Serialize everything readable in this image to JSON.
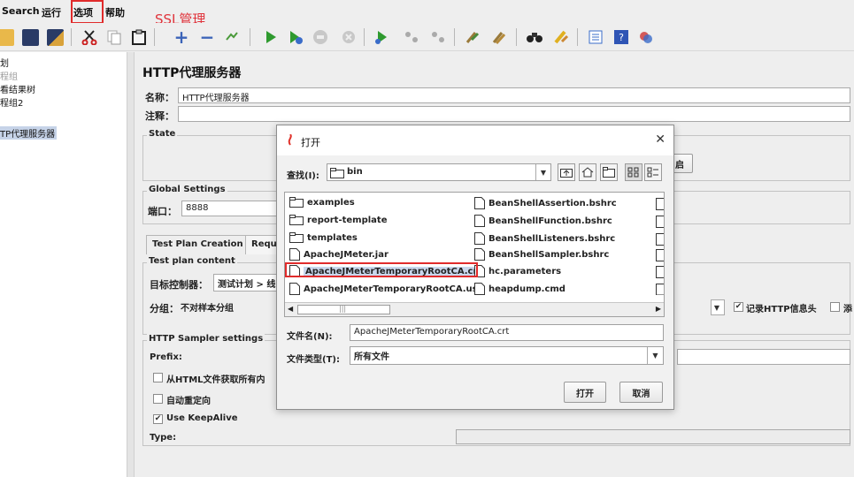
{
  "menu": {
    "items": [
      "Search",
      "运行",
      "选项",
      "帮助"
    ],
    "highlighted": "选项"
  },
  "annotation": {
    "text": "SSL管理",
    "color": "#e0323a"
  },
  "toolbar": {
    "icons": [
      "new-icon",
      "open-icon",
      "save-icon",
      "save-as-icon",
      "cut-icon",
      "copy-icon",
      "paste-icon",
      "expand-icon",
      "collapse-icon",
      "toggle-icon",
      "start-icon",
      "start-no-pause-icon",
      "stop-icon",
      "shutdown-icon",
      "remote-start-icon",
      "remote-stop-icon",
      "remote-shutdown-icon",
      "clear-icon",
      "clear-all-icon",
      "search-icon",
      "reset-search-icon",
      "function-helper-icon",
      "help-icon",
      "log-viewer-icon"
    ]
  },
  "tree": {
    "items": [
      {
        "label": "划",
        "state": "normal"
      },
      {
        "label": "程组",
        "state": "dim"
      },
      {
        "label": "看结果树",
        "state": "normal"
      },
      {
        "label": "程组2",
        "state": "normal"
      },
      {
        "label": "TP代理服务器",
        "state": "selected"
      }
    ]
  },
  "main": {
    "title": "HTTP代理服务器",
    "name_label": "名称：",
    "name_value": "HTTP代理服务器",
    "comment_label": "注释：",
    "comment_value": "",
    "state_group": "State",
    "start_btn_partial": "启",
    "global_group": "Global Settings",
    "port_label": "端口：",
    "port_value": "8888",
    "tabs": [
      "Test Plan Creation",
      "Requ"
    ],
    "test_plan_group": "Test plan content",
    "target_label": "目标控制器：",
    "target_value": "测试计划 > 线",
    "grouping_label": "分组：",
    "grouping_value": "不对样本分组",
    "record_headers_label": "记录HTTP信息头",
    "record_headers_checked": true,
    "partial_checkbox_label": "添",
    "sampler_group": "HTTP Sampler settings",
    "prefix_label": "Prefix:",
    "retrieve_label": "从HTML文件获取所有内",
    "redirect_label": "自动重定向",
    "keepalive_label": "Use KeepAlive",
    "keepalive_checked": true,
    "type_label": "Type:"
  },
  "dialog": {
    "title": "打开",
    "close": "✕",
    "look_in_label": "查找(I):",
    "look_in_value": "bin",
    "files_col1": [
      {
        "name": "examples",
        "kind": "folder"
      },
      {
        "name": "report-template",
        "kind": "folder"
      },
      {
        "name": "templates",
        "kind": "folder"
      },
      {
        "name": "ApacheJMeter.jar",
        "kind": "file"
      },
      {
        "name": "ApacheJMeterTemporaryRootCA.crt",
        "kind": "file",
        "selected": true
      },
      {
        "name": "ApacheJMeterTemporaryRootCA.usr",
        "kind": "file"
      }
    ],
    "files_col2": [
      {
        "name": "BeanShellAssertion.bshrc",
        "kind": "file"
      },
      {
        "name": "BeanShellFunction.bshrc",
        "kind": "file"
      },
      {
        "name": "BeanShellListeners.bshrc",
        "kind": "file"
      },
      {
        "name": "BeanShellSampler.bshrc",
        "kind": "file"
      },
      {
        "name": "hc.parameters",
        "kind": "file"
      },
      {
        "name": "heapdump.cmd",
        "kind": "file"
      }
    ],
    "scrollbar_grip": "|||",
    "filename_label": "文件名(N):",
    "filename_value": "ApacheJMeterTemporaryRootCA.crt",
    "filetype_label": "文件类型(T):",
    "filetype_value": "所有文件",
    "open_button": "打开",
    "cancel_button": "取消"
  }
}
